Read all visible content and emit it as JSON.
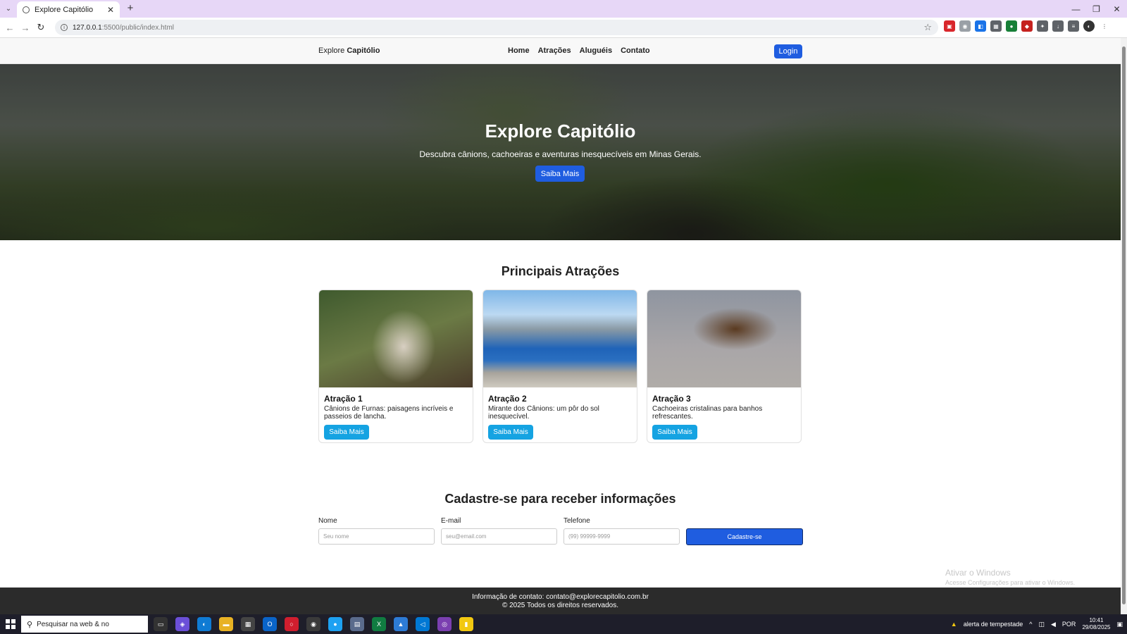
{
  "browser": {
    "tab_title": "Explore Capitólio",
    "url_host": "127.0.0.1",
    "url_path": ":5500/public/index.html"
  },
  "header": {
    "brand_prefix": "Explore",
    "brand_name": "Capitólio",
    "nav": [
      "Home",
      "Atrações",
      "Aluguéis",
      "Contato"
    ],
    "login_label": "Login"
  },
  "hero": {
    "title": "Explore Capitólio",
    "subtitle": "Descubra cânions, cachoeiras e aventuras inesquecíveis em Minas Gerais.",
    "button_label": "Saiba Mais"
  },
  "attractions": {
    "title": "Principais Atrações",
    "cards": [
      {
        "title": "Atração 1",
        "text": "Cânions de Furnas: paisagens incríveis e passeios de lancha.",
        "button_label": "Saiba Mais"
      },
      {
        "title": "Atração 2",
        "text": "Mirante dos Cânions: um pôr do sol inesquecível.",
        "button_label": "Saiba Mais"
      },
      {
        "title": "Atração 3",
        "text": "Cachoeiras cristalinas para banhos refrescantes.",
        "button_label": "Saiba Mais"
      }
    ]
  },
  "signup": {
    "title": "Cadastre-se para receber informações",
    "name_label": "Nome",
    "name_placeholder": "Seu nome",
    "email_label": "E-mail",
    "email_placeholder": "seu@email.com",
    "phone_label": "Telefone",
    "phone_placeholder": "(99) 99999-9999",
    "submit_label": "Cadastre-se"
  },
  "watermark": {
    "line1": "Ativar o Windows",
    "line2": "Acesse Configurações para ativar o Windows."
  },
  "footer": {
    "contact": "Informação de contato: contato@explorecapitolio.com.br",
    "copyright": "© 2025 Todos os direitos reservados."
  },
  "taskbar": {
    "search_placeholder": "Pesquisar na web & no",
    "weather": "alerta de tempestade",
    "language": "POR",
    "time": "10:41",
    "date": "29/08/2025"
  },
  "colors": {
    "primary_button": "#1f5de0",
    "card_button": "#15a3e2",
    "footer_bg": "#2b2b2b"
  }
}
